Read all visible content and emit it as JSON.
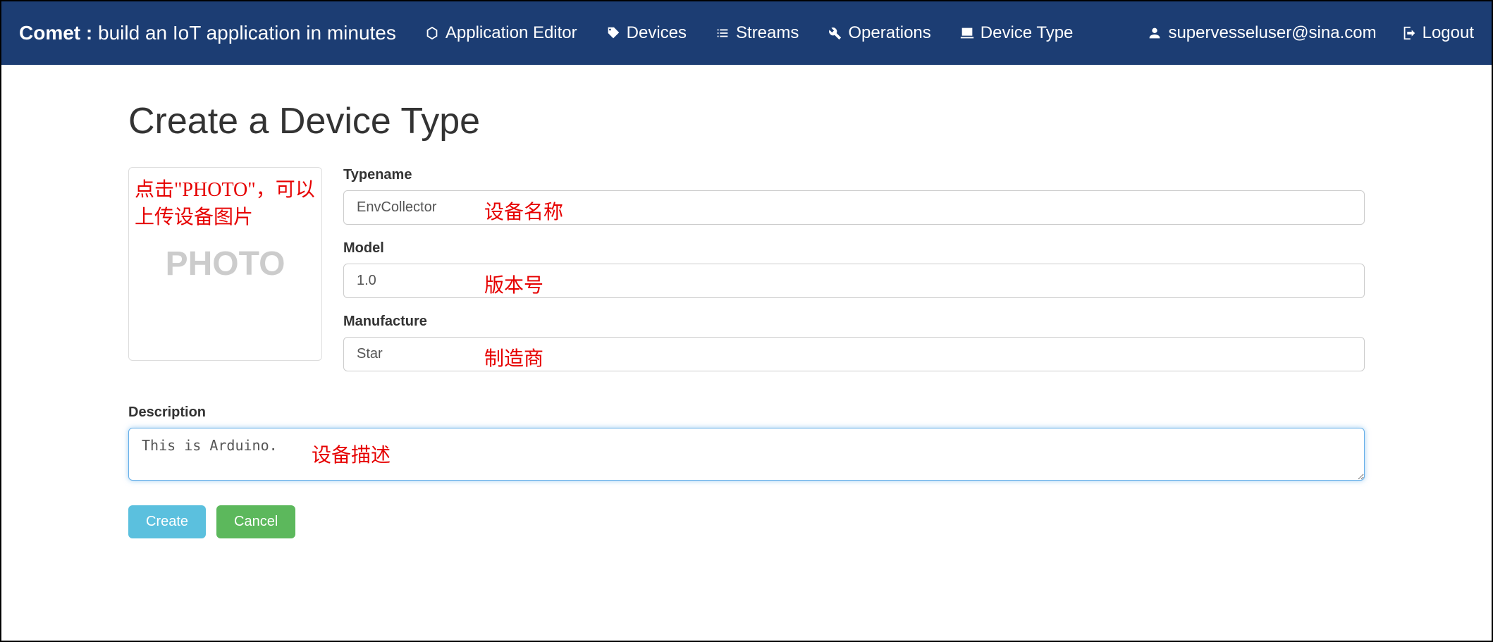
{
  "navbar": {
    "brand_main": "Comet :",
    "brand_sub": " build an IoT application in minutes",
    "items": [
      {
        "label": "Application Editor"
      },
      {
        "label": "Devices"
      },
      {
        "label": "Streams"
      },
      {
        "label": "Operations"
      },
      {
        "label": "Device Type"
      }
    ],
    "user": "supervesseluser@sina.com",
    "logout": "Logout"
  },
  "page": {
    "title": "Create a Device Type"
  },
  "photo": {
    "placeholder_text": "PHOTO",
    "annotation": "点击\"PHOTO\"，可以上传设备图片"
  },
  "form": {
    "typename": {
      "label": "Typename",
      "value": "EnvCollector",
      "annotation": "设备名称"
    },
    "model": {
      "label": "Model",
      "value": "1.0",
      "annotation": "版本号"
    },
    "manufacture": {
      "label": "Manufacture",
      "value": "Star",
      "annotation": "制造商"
    },
    "description": {
      "label": "Description",
      "value": "This is Arduino.",
      "annotation": "设备描述"
    }
  },
  "buttons": {
    "create": "Create",
    "cancel": "Cancel"
  }
}
